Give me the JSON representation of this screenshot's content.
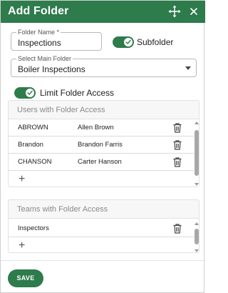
{
  "dialog": {
    "title": "Add Folder",
    "move_icon": "move-arrows-icon",
    "close_icon": "close-icon"
  },
  "folder_name": {
    "label": "Folder Name *",
    "value": "Inspections"
  },
  "subfolder_toggle": {
    "label": "Subfolder",
    "checked": true
  },
  "main_folder": {
    "label": "Select Main Folder",
    "value": "Boiler Inspections"
  },
  "limit_access_toggle": {
    "label": "Limit Folder Access",
    "checked": true
  },
  "users_panel": {
    "header": "Users with Folder Access",
    "rows": [
      {
        "username": "ABROWN",
        "name": "Allen Brown"
      },
      {
        "username": "Brandon",
        "name": "Brandon Farris"
      },
      {
        "username": "CHANSON",
        "name": "Carter Hanson"
      }
    ],
    "add_label": "+"
  },
  "teams_panel": {
    "header": "Teams with Folder Access",
    "rows": [
      {
        "team": "Inspectors"
      }
    ],
    "add_label": "+"
  },
  "footer": {
    "save_label": "SAVE"
  },
  "colors": {
    "accent": "#2e7b4c"
  }
}
